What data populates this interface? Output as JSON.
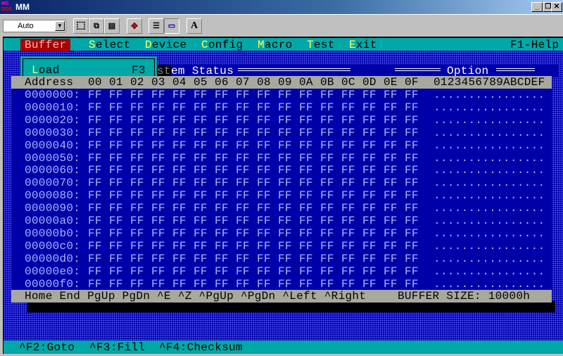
{
  "window": {
    "title": "MM",
    "icon_text": "MS DOS",
    "minimize": "_",
    "restore": "❐",
    "close": "✕"
  },
  "toolbar": {
    "font_size": "Auto",
    "font_button": "A"
  },
  "menu": {
    "items": [
      {
        "hotkey": "",
        "rest": "Buffer",
        "active": true
      },
      {
        "hotkey": "S",
        "rest": "elect"
      },
      {
        "hotkey": "D",
        "rest": "evice"
      },
      {
        "hotkey": "C",
        "rest": "onfig"
      },
      {
        "hotkey": "M",
        "rest": "acro"
      },
      {
        "hotkey": "T",
        "rest": "est"
      },
      {
        "hotkey": "E",
        "rest": "xit"
      }
    ],
    "help": "F1-Help"
  },
  "dropdown": {
    "hotkey": "L",
    "rest": "oad",
    "shortcut": "F3"
  },
  "behind": {
    "status_prefix": "st",
    "status_title": "em Status",
    "option_title": "Option"
  },
  "grid": {
    "header_address": "Address",
    "columns": [
      "00",
      "01",
      "02",
      "03",
      "04",
      "05",
      "06",
      "07",
      "08",
      "09",
      "0A",
      "0B",
      "0C",
      "0D",
      "0E",
      "0F"
    ],
    "ascii_header": "0123456789ABCDEF",
    "rows": [
      {
        "address": "0000000:",
        "bytes": "FF",
        "ascii": "................"
      },
      {
        "address": "0000010:",
        "bytes": "FF",
        "ascii": "................"
      },
      {
        "address": "0000020:",
        "bytes": "FF",
        "ascii": "................"
      },
      {
        "address": "0000030:",
        "bytes": "FF",
        "ascii": "................"
      },
      {
        "address": "0000040:",
        "bytes": "FF",
        "ascii": "................"
      },
      {
        "address": "0000050:",
        "bytes": "FF",
        "ascii": "................"
      },
      {
        "address": "0000060:",
        "bytes": "FF",
        "ascii": "................"
      },
      {
        "address": "0000070:",
        "bytes": "FF",
        "ascii": "................"
      },
      {
        "address": "0000080:",
        "bytes": "FF",
        "ascii": "................"
      },
      {
        "address": "0000090:",
        "bytes": "FF",
        "ascii": "................"
      },
      {
        "address": "00000a0:",
        "bytes": "FF",
        "ascii": "................"
      },
      {
        "address": "00000b0:",
        "bytes": "FF",
        "ascii": "................"
      },
      {
        "address": "00000c0:",
        "bytes": "FF",
        "ascii": "................"
      },
      {
        "address": "00000d0:",
        "bytes": "FF",
        "ascii": "................"
      },
      {
        "address": "00000e0:",
        "bytes": "FF",
        "ascii": "................"
      },
      {
        "address": "00000f0:",
        "bytes": "FF",
        "ascii": "................"
      }
    ]
  },
  "keys_bar": {
    "keys": "Home End PgUp PgDn ^E ^Z ^PgUp ^PgDn ^Left ^Right",
    "buffer_size": "BUFFER SIZE: 10000h"
  },
  "bottom_bar": {
    "items": [
      "^F2:Goto",
      "^F3:Fill",
      "^F4:Checksum"
    ]
  }
}
